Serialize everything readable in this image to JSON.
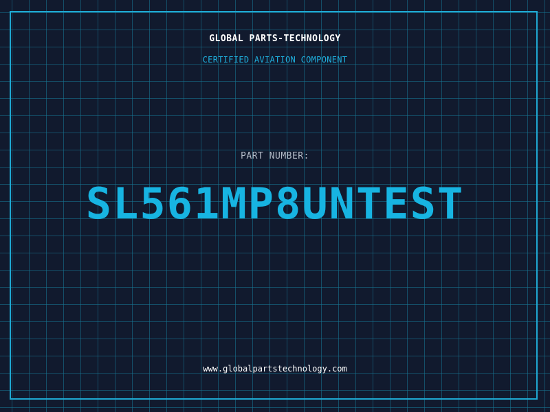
{
  "header": {
    "brand": "GLOBAL PARTS-TECHNOLOGY",
    "subtitle": "CERTIFIED AVIATION COMPONENT"
  },
  "part": {
    "label": "PART NUMBER:",
    "number": "SL561MP8UNTEST"
  },
  "footer": {
    "url": "www.globalpartstechnology.com"
  },
  "colors": {
    "background": "#111a2e",
    "grid": "#16788f",
    "accent": "#1fa8d2",
    "part_number": "#17b4e2",
    "label": "#b4bcc8",
    "text": "#ffffff"
  }
}
